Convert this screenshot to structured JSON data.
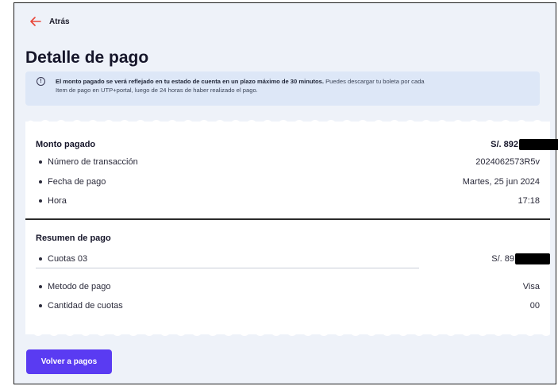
{
  "nav": {
    "back_label": "Atrás"
  },
  "page": {
    "title": "Detalle de pago"
  },
  "info": {
    "bold_text": "El monto pagado se verá reflejado en tu estado de cuenta en un plazo máximo de 30 minutos.",
    "text_line1": " Puedes descargar tu boleta por cada",
    "text_line2": "Item de pago en UTP+portal, luego de 24 horas de haber realizado el pago."
  },
  "payment": {
    "label": "Monto pagado",
    "amount_visible": "S/. 892",
    "details": [
      {
        "label": "Número de transacción",
        "value": "2024062573R5v"
      },
      {
        "label": "Fecha de pago",
        "value": "Martes, 25 jun 2024"
      },
      {
        "label": "Hora",
        "value": "17:18"
      }
    ]
  },
  "summary": {
    "label": "Resumen de pago",
    "installments_label": "Cuotas 03",
    "installments_amount_visible": "S/. 89",
    "method_label": "Metodo de pago",
    "method_value": "Visa",
    "count_label": "Cantidad de cuotas",
    "count_value": "00"
  },
  "actions": {
    "back_to_payments": "Volver a pagos"
  },
  "colors": {
    "accent": "#5a3bf2",
    "back_arrow": "#e8473a",
    "background": "#eef2f9",
    "info_bg": "#dde7f7"
  },
  "icons": {
    "back": "arrow-left-icon",
    "info": "info-circle-icon"
  }
}
